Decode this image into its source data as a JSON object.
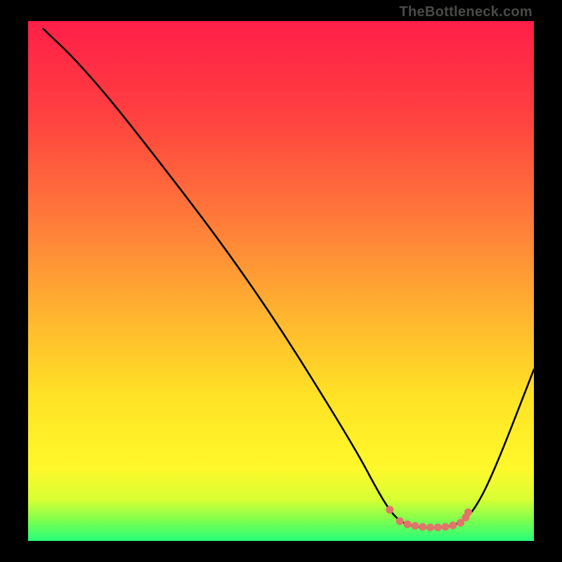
{
  "attribution": "TheBottleneck.com",
  "colors": {
    "bg": "#000000",
    "curve": "#000000",
    "marker": "#e0756a",
    "gradient_stops": [
      {
        "pct": 0,
        "color": "#ff1f48"
      },
      {
        "pct": 18,
        "color": "#ff4040"
      },
      {
        "pct": 38,
        "color": "#ff7a3a"
      },
      {
        "pct": 55,
        "color": "#ffb030"
      },
      {
        "pct": 72,
        "color": "#ffe225"
      },
      {
        "pct": 86,
        "color": "#fff82a"
      },
      {
        "pct": 92,
        "color": "#d8ff34"
      },
      {
        "pct": 96,
        "color": "#7dff4e"
      },
      {
        "pct": 100,
        "color": "#25ff7c"
      }
    ]
  },
  "chart_data": {
    "type": "line",
    "title": "",
    "xlabel": "",
    "ylabel": "",
    "xlim": [
      0,
      100
    ],
    "ylim": [
      0,
      100
    ],
    "grid": false,
    "legend": false,
    "curve": [
      {
        "x": 3,
        "y": 98.5
      },
      {
        "x": 10,
        "y": 92
      },
      {
        "x": 20,
        "y": 80.5
      },
      {
        "x": 44,
        "y": 50
      },
      {
        "x": 64,
        "y": 19
      },
      {
        "x": 70,
        "y": 8
      },
      {
        "x": 73,
        "y": 4
      },
      {
        "x": 76,
        "y": 2.8
      },
      {
        "x": 79,
        "y": 2.5
      },
      {
        "x": 82,
        "y": 2.6
      },
      {
        "x": 85,
        "y": 3.2
      },
      {
        "x": 88,
        "y": 5.5
      },
      {
        "x": 92,
        "y": 13
      },
      {
        "x": 100,
        "y": 33
      }
    ],
    "markers": [
      {
        "x": 71.5,
        "y": 6.0
      },
      {
        "x": 73.5,
        "y": 3.8
      },
      {
        "x": 75.0,
        "y": 3.2
      },
      {
        "x": 76.5,
        "y": 2.9
      },
      {
        "x": 78.0,
        "y": 2.7
      },
      {
        "x": 79.5,
        "y": 2.6
      },
      {
        "x": 81.0,
        "y": 2.6
      },
      {
        "x": 82.5,
        "y": 2.7
      },
      {
        "x": 84.0,
        "y": 3.0
      },
      {
        "x": 85.5,
        "y": 3.5
      },
      {
        "x": 86.5,
        "y": 4.5
      },
      {
        "x": 87.0,
        "y": 5.5
      }
    ]
  }
}
